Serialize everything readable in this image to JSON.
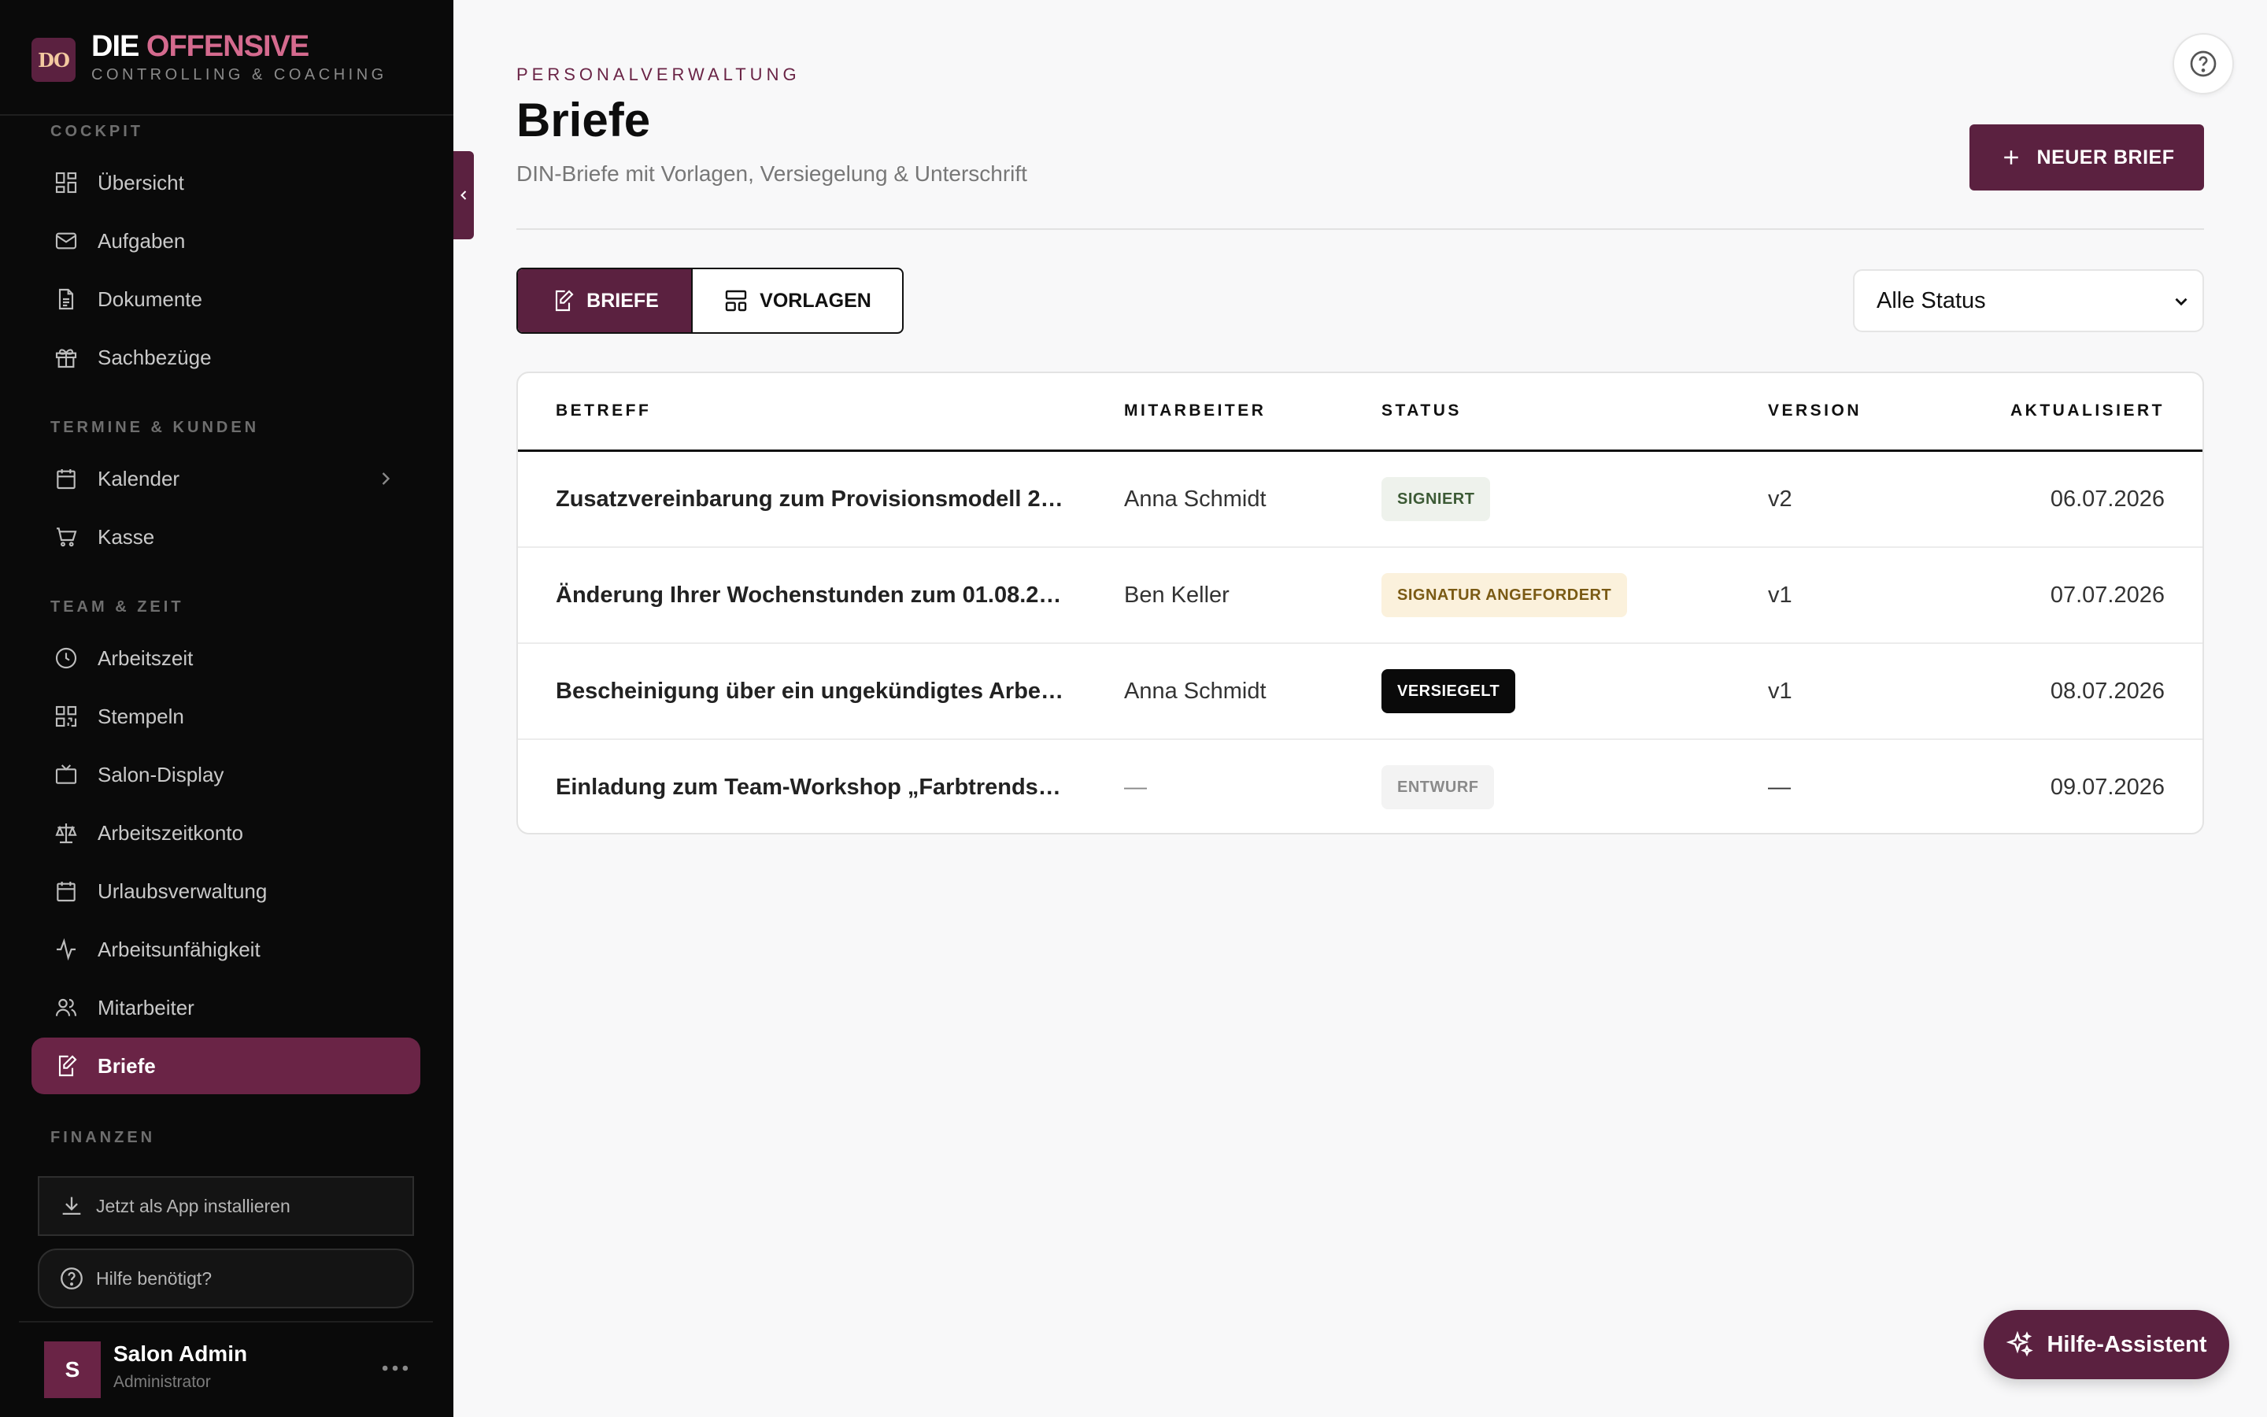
{
  "brand": {
    "logo_text": "DO",
    "title_main": "DIE ",
    "title_accent": "OFFENSIVE",
    "subtitle": "CONTROLLING & COACHING"
  },
  "sidebar": {
    "sections": {
      "cockpit": "COCKPIT",
      "termine": "TERMINE & KUNDEN",
      "team": "TEAM & ZEIT",
      "finanzen": "FINANZEN"
    },
    "items": [
      {
        "label": "Übersicht",
        "icon": "dashboard-icon"
      },
      {
        "label": "Aufgaben",
        "icon": "mail-icon"
      },
      {
        "label": "Dokumente",
        "icon": "document-icon"
      },
      {
        "label": "Sachbezüge",
        "icon": "gift-icon"
      },
      {
        "label": "Kalender",
        "icon": "calendar-icon"
      },
      {
        "label": "Kasse",
        "icon": "cart-icon"
      },
      {
        "label": "Arbeitszeit",
        "icon": "clock-icon"
      },
      {
        "label": "Stempeln",
        "icon": "qr-code-icon"
      },
      {
        "label": "Salon-Display",
        "icon": "tv-icon"
      },
      {
        "label": "Arbeitszeitkonto",
        "icon": "scale-icon"
      },
      {
        "label": "Urlaubsverwaltung",
        "icon": "calendar-icon"
      },
      {
        "label": "Arbeitsunfähigkeit",
        "icon": "activity-icon"
      },
      {
        "label": "Mitarbeiter",
        "icon": "users-icon"
      },
      {
        "label": "Briefe",
        "icon": "edit-document-icon",
        "active": true
      }
    ],
    "install_label": "Jetzt als App installieren",
    "help_label": "Hilfe benötigt?",
    "user": {
      "initial": "S",
      "name": "Salon Admin",
      "role": "Administrator"
    }
  },
  "header": {
    "eyebrow": "PERSONALVERWALTUNG",
    "title": "Briefe",
    "subtitle": "DIN-Briefe mit Vorlagen, Versiegelung & Unterschrift",
    "new_button": "NEUER BRIEF"
  },
  "tabs": {
    "letters": "BRIEFE",
    "templates": "VORLAGEN"
  },
  "filter": {
    "selected": "Alle Status"
  },
  "table": {
    "columns": [
      "BETREFF",
      "MITARBEITER",
      "STATUS",
      "VERSION",
      "AKTUALISIERT"
    ],
    "rows": [
      {
        "subject": "Zusatzvereinbarung zum Provisionsmodell 2…",
        "employee": "Anna Schmidt",
        "status": "SIGNIERT",
        "version": "v2",
        "updated": "06.07.2026"
      },
      {
        "subject": "Änderung Ihrer Wochenstunden zum 01.08.2…",
        "employee": "Ben Keller",
        "status": "SIGNATUR ANGEFORDERT",
        "version": "v1",
        "updated": "07.07.2026"
      },
      {
        "subject": "Bescheinigung über ein ungekündigtes Arbe…",
        "employee": "Anna Schmidt",
        "status": "VERSIEGELT",
        "version": "v1",
        "updated": "08.07.2026"
      },
      {
        "subject": "Einladung zum Team-Workshop „Farbtrends…",
        "employee": "—",
        "status": "ENTWURF",
        "version": "—",
        "updated": "09.07.2026"
      }
    ]
  },
  "assistant": {
    "label": "Hilfe-Assistent"
  },
  "colors": {
    "accent": "#5b2140",
    "accent_active": "#6a2446",
    "sidebar_bg": "#0a0a0a",
    "badge_signed_bg": "#eef2ec",
    "badge_signed_fg": "#3c5a35",
    "badge_requested_bg": "#fbf1dc",
    "badge_requested_fg": "#7a5a14",
    "badge_sealed_bg": "#0a0a0a",
    "badge_sealed_fg": "#ffffff",
    "badge_draft_bg": "#f3f3f3",
    "badge_draft_fg": "#8a8a8a"
  }
}
